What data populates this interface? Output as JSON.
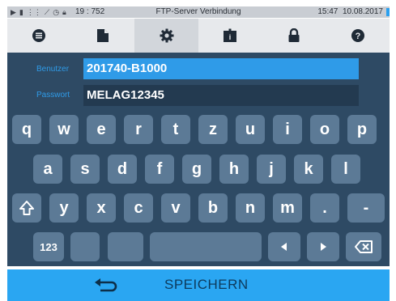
{
  "status": {
    "counter": "19 : 752",
    "title": "FTP-Server Verbindung",
    "time": "15:47",
    "date": "10.08.2017"
  },
  "tabs": [
    {
      "icon": "list-icon",
      "active": false
    },
    {
      "icon": "document-icon",
      "active": false
    },
    {
      "icon": "gear-icon",
      "active": true
    },
    {
      "icon": "info-card-icon",
      "active": false
    },
    {
      "icon": "lock-icon",
      "active": false
    },
    {
      "icon": "help-icon",
      "active": false
    }
  ],
  "form": {
    "user_label": "Benutzer",
    "user_value": "201740-B1000",
    "password_label": "Passwort",
    "password_value": "MELAG12345"
  },
  "keyboard": {
    "row1": [
      "q",
      "w",
      "e",
      "r",
      "t",
      "z",
      "u",
      "i",
      "o",
      "p"
    ],
    "row2": [
      "a",
      "s",
      "d",
      "f",
      "g",
      "h",
      "j",
      "k",
      "l"
    ],
    "row3": [
      "y",
      "x",
      "c",
      "v",
      "b",
      "n",
      "m",
      ".",
      "-"
    ],
    "numbers_key": "123"
  },
  "footer": {
    "save_label": "SPEICHERN"
  },
  "colors": {
    "accent": "#2aa6f2",
    "panel": "#2e4a64",
    "key": "#5c7a96"
  }
}
